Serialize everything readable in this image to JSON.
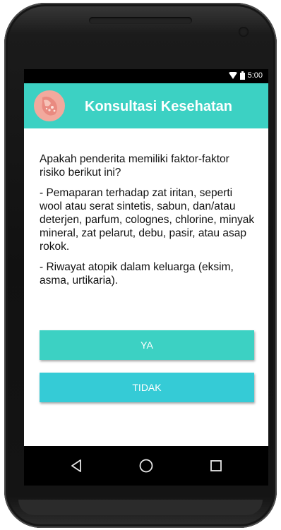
{
  "statusbar": {
    "time": "5:00",
    "icons": [
      "wifi-icon",
      "battery-icon"
    ]
  },
  "appbar": {
    "title": "Konsultasi Kesehatan",
    "logo": "skin-rash-logo-icon"
  },
  "question": {
    "prompt": "Apakah penderita memiliki faktor-faktor risiko berikut ini?",
    "factor_1": "- Pemaparan terhadap zat iritan, seperti wool atau serat sintetis, sabun, dan/atau deterjen, parfum, colognes, chlorine, minyak mineral, zat pelarut, debu, pasir, atau asap rokok.",
    "factor_2": "- Riwayat atopik dalam keluarga (eksim, asma, urtikaria)."
  },
  "buttons": {
    "yes_label": "YA",
    "no_label": "TIDAK"
  },
  "navbar": {
    "icons": [
      "back-icon",
      "home-icon",
      "recents-icon"
    ]
  },
  "colors": {
    "accent": "#3cd1c3",
    "button_no": "#35cbd6",
    "device": "#151515"
  }
}
